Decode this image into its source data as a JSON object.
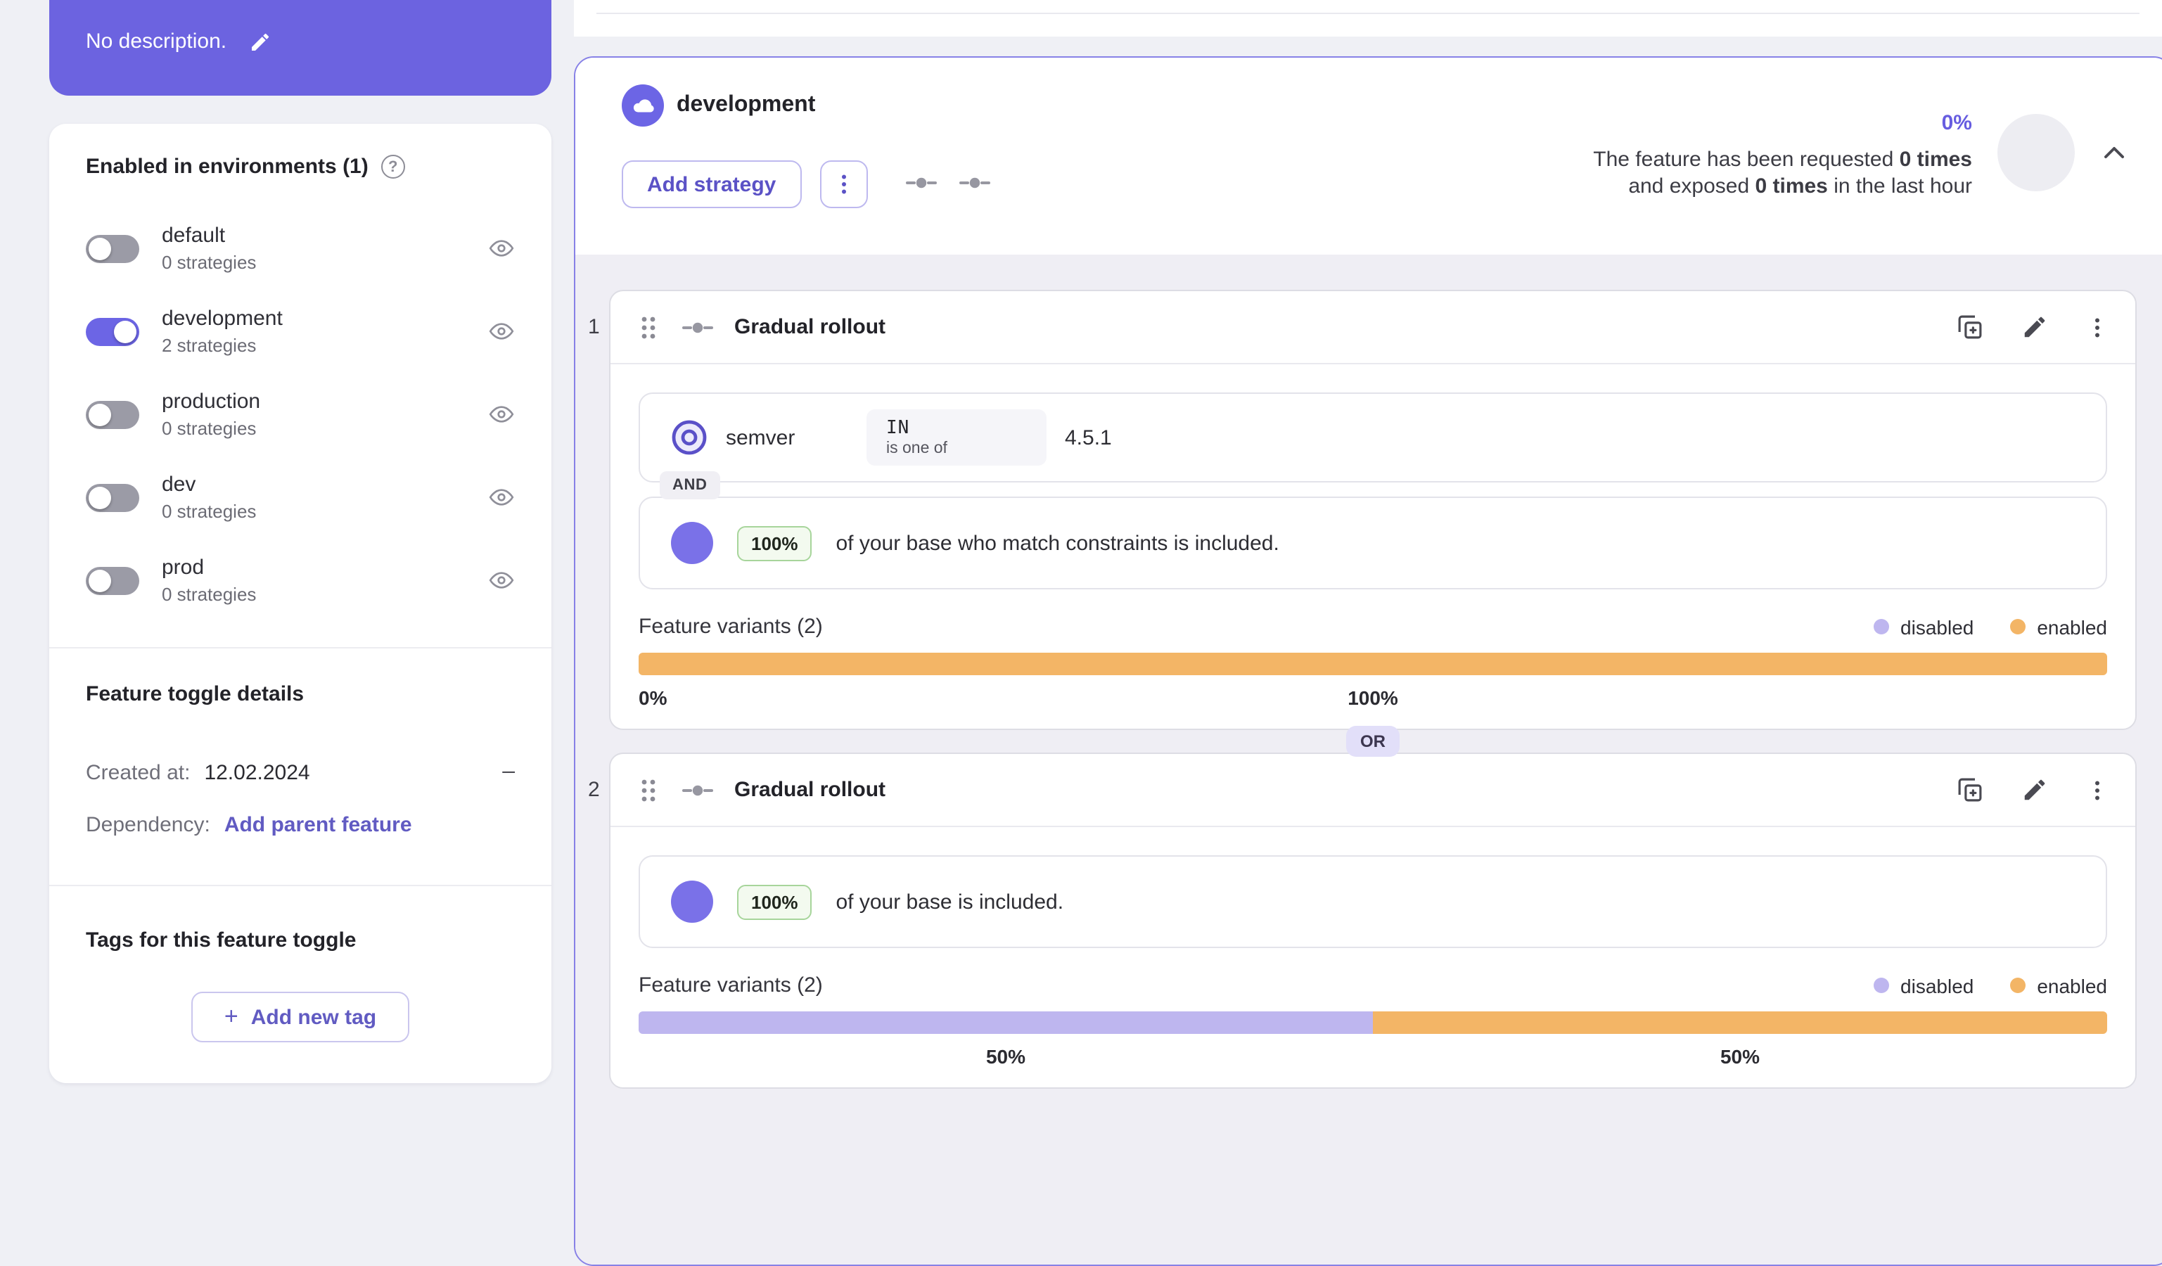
{
  "colors": {
    "accent": "#615bc2",
    "toggle_on": "#6c65e5",
    "header_purple": "#6c63e0",
    "rollout_circle": "#7a71e8",
    "card_border": "#8781e6",
    "variant_disabled": "#beb6ef",
    "variant_enabled": "#f3b566"
  },
  "icons": {
    "help_glyph": "?"
  },
  "sidebar": {
    "description": {
      "text": "No description."
    },
    "environments": {
      "title": "Enabled in environments (1)",
      "items": [
        {
          "name": "default",
          "strategies": "0 strategies",
          "enabled": false
        },
        {
          "name": "development",
          "strategies": "2 strategies",
          "enabled": true
        },
        {
          "name": "production",
          "strategies": "0 strategies",
          "enabled": false
        },
        {
          "name": "dev",
          "strategies": "0 strategies",
          "enabled": false
        },
        {
          "name": "prod",
          "strategies": "0 strategies",
          "enabled": false
        }
      ]
    },
    "details": {
      "title": "Feature toggle details",
      "created_label": "Created at:",
      "created_value": "12.02.2024",
      "collapse_glyph": "–",
      "dependency_label": "Dependency:",
      "dependency_link": "Add parent feature"
    },
    "tags": {
      "title": "Tags for this feature toggle",
      "plus_glyph": "+",
      "add_label": "Add new tag"
    }
  },
  "main": {
    "header": {
      "environment": "development",
      "add_strategy_label": "Add strategy",
      "exposure_percent": "0%",
      "requested_prefix": "The feature has been requested ",
      "requested_bold": "0 times",
      "exposed_prefix": "and exposed ",
      "exposed_bold": "0 times",
      "exposed_suffix": " in the last hour"
    },
    "or_label": "OR",
    "strategies": [
      {
        "index": "1",
        "title": "Gradual rollout",
        "constraint": {
          "field": "semver",
          "operator": "IN",
          "operator_caption": "is one of",
          "value": "4.5.1"
        },
        "joiner": "AND",
        "rollout_percent": "100%",
        "rollout_text": "of your base who match constraints is included.",
        "variants": {
          "label": "Feature variants (2)",
          "legend": [
            "disabled",
            "enabled"
          ],
          "segments": [
            {
              "name": "disabled",
              "percent": 0
            },
            {
              "name": "enabled",
              "percent": 100
            }
          ],
          "labels": [
            {
              "text": "0%",
              "at": 0,
              "anchor": "left"
            },
            {
              "text": "100%",
              "at": 50,
              "anchor": "center"
            }
          ]
        }
      },
      {
        "index": "2",
        "title": "Gradual rollout",
        "rollout_percent": "100%",
        "rollout_text": "of your base is included.",
        "variants": {
          "label": "Feature variants (2)",
          "legend": [
            "disabled",
            "enabled"
          ],
          "segments": [
            {
              "name": "disabled",
              "percent": 50
            },
            {
              "name": "enabled",
              "percent": 50
            }
          ],
          "labels": [
            {
              "text": "50%",
              "at": 25,
              "anchor": "center"
            },
            {
              "text": "50%",
              "at": 75,
              "anchor": "center"
            }
          ]
        }
      }
    ]
  }
}
